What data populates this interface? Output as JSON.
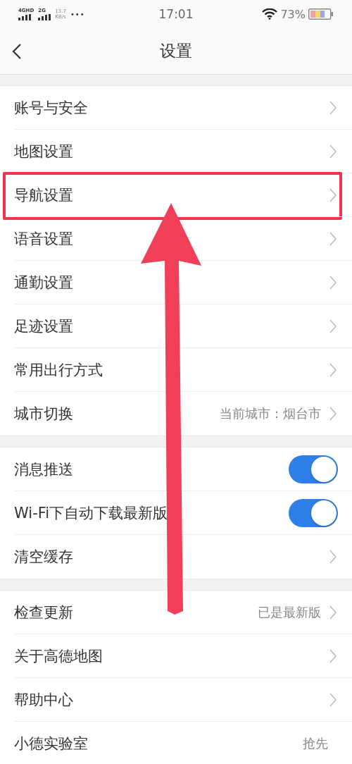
{
  "status_bar": {
    "network_1": "4GHD",
    "network_2": "2G",
    "speed": "13.7",
    "speed_unit": "KB/s",
    "more": "•••",
    "time": "17:01",
    "battery": "73%"
  },
  "header": {
    "title": "设置"
  },
  "groups": [
    [
      {
        "kind": "link",
        "label": "账号与安全",
        "highlighted": false
      },
      {
        "kind": "link",
        "label": "地图设置",
        "highlighted": false
      },
      {
        "kind": "link",
        "label": "导航设置",
        "highlighted": true
      },
      {
        "kind": "link",
        "label": "语音设置",
        "highlighted": false
      },
      {
        "kind": "link",
        "label": "通勤设置",
        "highlighted": false
      },
      {
        "kind": "link",
        "label": "足迹设置",
        "highlighted": false
      },
      {
        "kind": "link",
        "label": "常用出行方式",
        "highlighted": false
      },
      {
        "kind": "link",
        "label": "城市切换",
        "value": "当前城市：烟台市",
        "highlighted": false
      }
    ],
    [
      {
        "kind": "toggle",
        "label": "消息推送",
        "on": true,
        "highlighted": false
      },
      {
        "kind": "toggle",
        "label": "Wi-Fi下自动下载最新版",
        "on": true,
        "highlighted": false
      },
      {
        "kind": "link",
        "label": "清空缓存",
        "highlighted": false
      }
    ],
    [
      {
        "kind": "link",
        "label": "检查更新",
        "value": "已是最新版",
        "highlighted": false
      },
      {
        "kind": "link",
        "label": "关于高德地图",
        "highlighted": false
      },
      {
        "kind": "link",
        "label": "帮助中心",
        "highlighted": false
      },
      {
        "kind": "value",
        "label": "小德实验室",
        "value": "抢先",
        "highlighted": false
      }
    ]
  ]
}
